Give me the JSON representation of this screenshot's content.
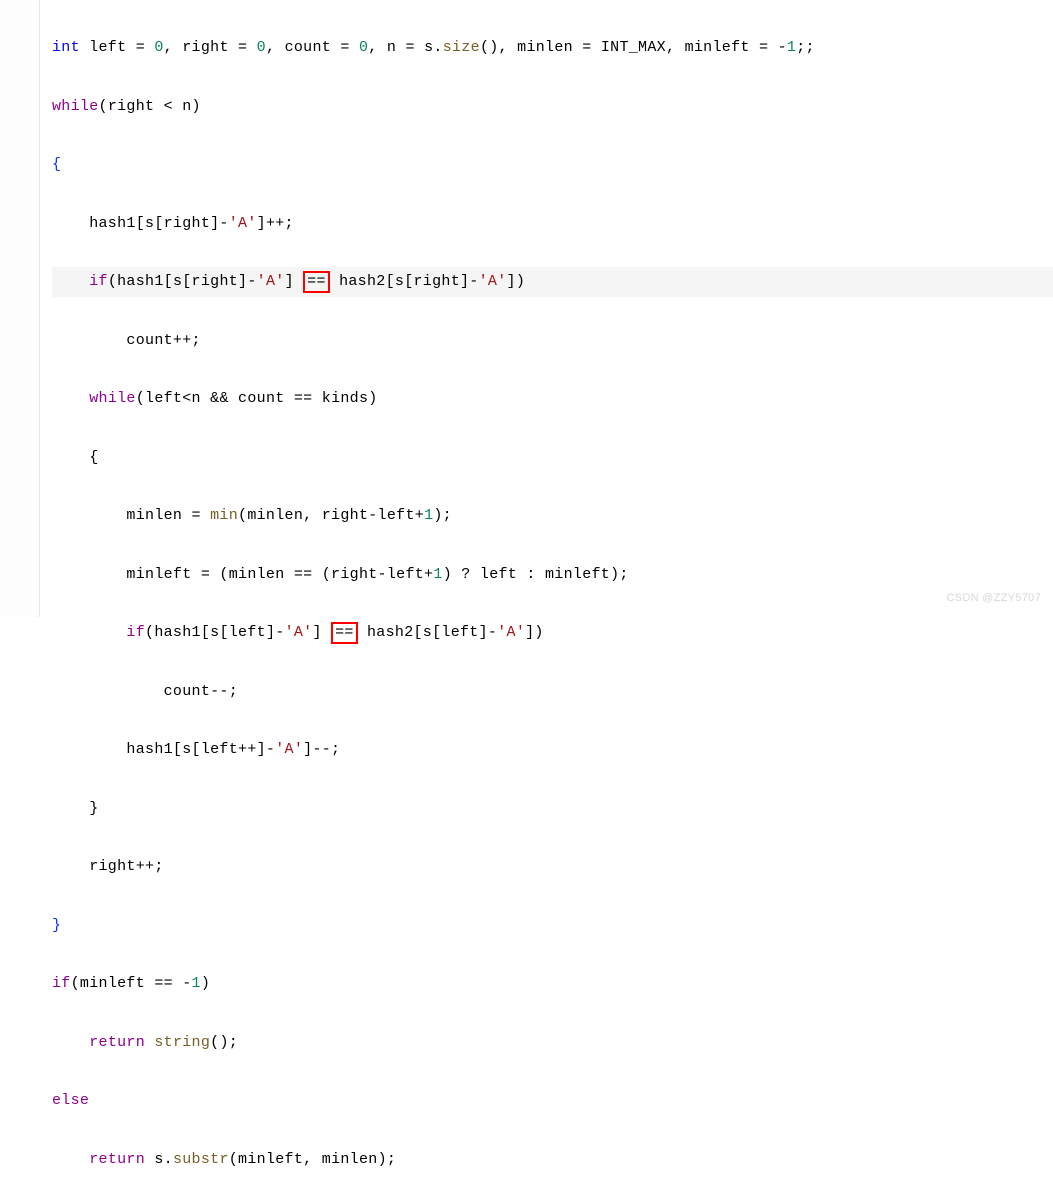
{
  "code": {
    "l1_p1": "int",
    "l1_p2": " left = ",
    "l1_n0": "0",
    "l1_p3": ", right = ",
    "l1_n1": "0",
    "l1_p4": ", count = ",
    "l1_n2": "0",
    "l1_p5": ", n = s.",
    "l1_fn": "size",
    "l1_p6": "(), minlen = INT_MAX, minleft = -",
    "l1_n3": "1",
    "l1_p7": ";;",
    "l2_kw": "while",
    "l2_cond": "(right < n)",
    "l3": "{",
    "l4_p1": "    hash1[s[right]-",
    "l4_str": "'A'",
    "l4_p2": "]++;",
    "l5_kw": "if",
    "l5_p1": "(hash1[s[right]-",
    "l5_str1": "'A'",
    "l5_p2": "] ",
    "l5_eq": "==",
    "l5_p3": " hash2[s[right]-",
    "l5_str2": "'A'",
    "l5_p4": "])",
    "l6": "        count++;",
    "l7_kw": "while",
    "l7_cond": "(left<n && count == kinds)",
    "l8": "    {",
    "l9_p1": "        minlen = ",
    "l9_fn": "min",
    "l9_p2": "(minlen, right-left+",
    "l9_n": "1",
    "l9_p3": ");",
    "l10_p1": "        minleft = (minlen == (right-left+",
    "l10_n": "1",
    "l10_p2": ") ? left : minleft);",
    "l11_kw": "if",
    "l11_p1": "(hash1[s[left]-",
    "l11_str1": "'A'",
    "l11_p2": "] ",
    "l11_eq": "==",
    "l11_p3": " hash2[s[left]-",
    "l11_str2": "'A'",
    "l11_p4": "])",
    "l12": "            count--;",
    "l13_p1": "        hash1[s[left++]-",
    "l13_str": "'A'",
    "l13_p2": "]--;",
    "l14": "    }",
    "l15": "    right++;",
    "l16": "}",
    "l17_kw": "if",
    "l17_p1": "(minleft == -",
    "l17_n": "1",
    "l17_p2": ")",
    "l18_kw": "return",
    "l18_p1": " ",
    "l18_fn": "string",
    "l18_p2": "();",
    "l19_kw": "else",
    "l20_kw": "return",
    "l20_p1": " s.",
    "l20_fn": "substr",
    "l20_p2": "(minleft, minlen);"
  },
  "watermark": "CSDN @ZZY5707"
}
